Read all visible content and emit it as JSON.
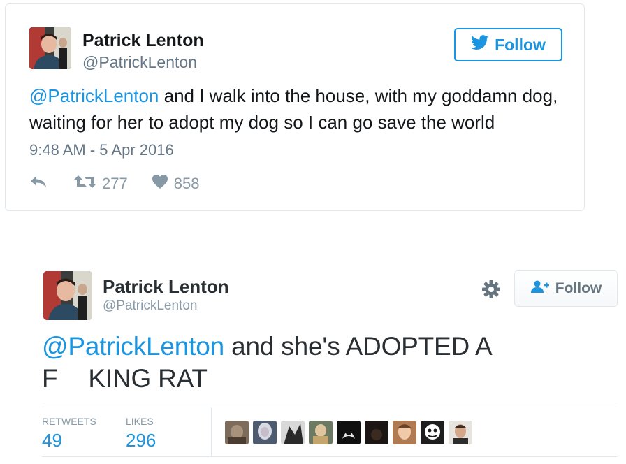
{
  "tweet1": {
    "name": "Patrick Lenton",
    "handle": "@PatrickLenton",
    "follow_label": "Follow",
    "mention": "@PatrickLenton",
    "text": " and I walk into the house, with my goddamn dog, waiting for her to adopt my dog so I can go save the world",
    "timestamp": "9:48 AM - 5 Apr 2016",
    "retweets": "277",
    "likes": "858",
    "accent": "#1b95e0",
    "icons": [
      "twitter-bird-icon",
      "reply-icon",
      "retweet-icon",
      "heart-icon"
    ]
  },
  "tweet2": {
    "name": "Patrick Lenton",
    "handle": "@PatrickLenton",
    "follow_label": "Follow",
    "mention": "@PatrickLenton",
    "text_line1": " and she's ADOPTED A",
    "text_line2_a": "F",
    "text_line2_b": "KING RAT",
    "retweets_label": "RETWEETS",
    "retweets_count": "49",
    "likes_label": "LIKES",
    "likes_count": "296",
    "liker_avatar_count": 9,
    "icons": [
      "gear-icon",
      "add-user-icon"
    ]
  }
}
